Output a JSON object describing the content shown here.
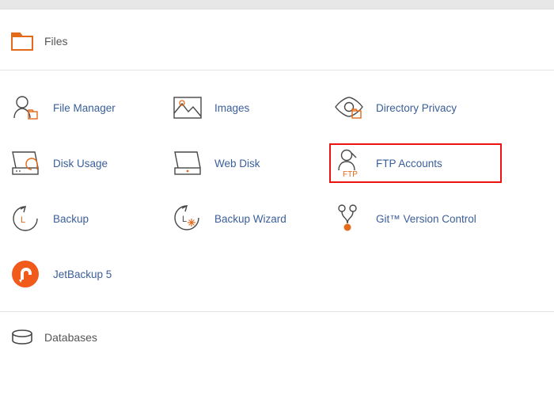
{
  "sections": {
    "files": {
      "title": "Files"
    },
    "databases": {
      "title": "Databases"
    }
  },
  "tools": {
    "file_manager": "File Manager",
    "images": "Images",
    "directory_privacy": "Directory Privacy",
    "disk_usage": "Disk Usage",
    "web_disk": "Web Disk",
    "ftp_accounts": "FTP Accounts",
    "backup": "Backup",
    "backup_wizard": "Backup Wizard",
    "git_version_control": "Git™ Version Control",
    "jetbackup5": "JetBackup 5"
  },
  "highlighted": "ftp_accounts"
}
